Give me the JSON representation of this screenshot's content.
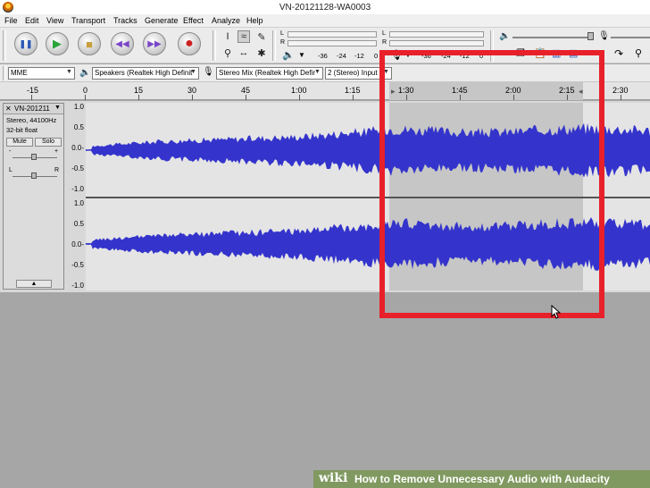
{
  "window": {
    "title": "VN-20121128-WA0003"
  },
  "menu": [
    "File",
    "Edit",
    "View",
    "Transport",
    "Tracks",
    "Generate",
    "Effect",
    "Analyze",
    "Help"
  ],
  "transport": {
    "buttons": [
      {
        "name": "pause",
        "glyph": "❚❚",
        "color": "#2a57b8"
      },
      {
        "name": "play",
        "glyph": "▶",
        "color": "#2aa43a"
      },
      {
        "name": "stop",
        "glyph": "■",
        "color": "#c8a040"
      },
      {
        "name": "skip-start",
        "glyph": "⏮",
        "color": "#7a45c8"
      },
      {
        "name": "skip-end",
        "glyph": "⏭",
        "color": "#7a45c8"
      },
      {
        "name": "record",
        "glyph": "●",
        "color": "#cc2020"
      }
    ]
  },
  "meters": {
    "output": {
      "left": "L",
      "right": "R",
      "scale": [
        "-36",
        "-24",
        "-12",
        "0"
      ]
    },
    "input": {
      "left": "L",
      "right": "R",
      "scale": [
        "-36",
        "-24",
        "-12",
        "0"
      ]
    }
  },
  "devices": {
    "host": "MME",
    "output_device": "Speakers (Realtek High Definit",
    "input_device": "Stereo Mix (Realtek High Defir",
    "channels": "2 (Stereo) Input"
  },
  "ruler": {
    "labels": [
      "-15",
      "0",
      "15",
      "30",
      "45",
      "1:00",
      "1:15",
      "1:30",
      "1:45",
      "2:00",
      "2:15",
      "2:30"
    ]
  },
  "track": {
    "name": "VN-201211",
    "rate": "Stereo, 44100Hz",
    "format": "32-bit float",
    "mute": "Mute",
    "solo": "Solo",
    "gain_minus": "-",
    "gain_plus": "+",
    "pan_left": "L",
    "pan_right": "R",
    "collapse": "▲",
    "scale_top": [
      "1.0",
      "0.5",
      "0.0-",
      "-0.5",
      "-1.0"
    ],
    "scale_bottom": [
      "1.0",
      "0.5",
      "0.0-",
      "-0.5",
      "-1.0"
    ]
  },
  "footer": {
    "brand": "wiki",
    "text": "How to Remove Unnecessary Audio with Audacity"
  },
  "colors": {
    "wave": "#3434cc",
    "wave_light": "#6464dd",
    "selection": "#c6c6c6",
    "highlight": "#e8202a"
  }
}
